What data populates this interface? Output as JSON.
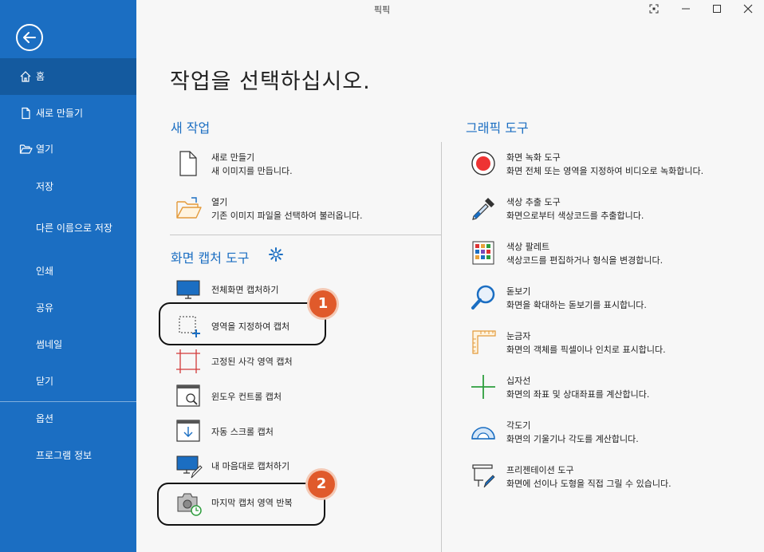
{
  "window": {
    "title": "픽픽",
    "icons": [
      "capture-icon",
      "minimize-icon",
      "maximize-icon",
      "close-icon"
    ]
  },
  "sidebar": {
    "back_icon": "arrow-left-icon",
    "items": [
      {
        "label": "홈",
        "icon": "home-icon",
        "active": true
      },
      {
        "label": "새로 만들기",
        "icon": "file-icon"
      },
      {
        "label": "열기",
        "icon": "folder-open-icon"
      },
      {
        "label": "저장"
      },
      {
        "label": "다른 이름으로 저장"
      },
      {
        "label": "인쇄"
      },
      {
        "label": "공유"
      },
      {
        "label": "썸네일"
      },
      {
        "label": "닫기"
      },
      {
        "label": "옵션"
      },
      {
        "label": "프로그램 정보"
      }
    ],
    "colors": {
      "background": "#1b6ec2",
      "active": "#145a9f"
    }
  },
  "main": {
    "title": "작업을 선택하십시오.",
    "new_task": {
      "heading": "새 작업",
      "items": [
        {
          "title": "새로 만들기",
          "desc": "새 이미지를 만듭니다.",
          "icon": "blank-file-icon"
        },
        {
          "title": "열기",
          "desc": "기존 이미지 파일을 선택하여 불러옵니다.",
          "icon": "open-folder-icon"
        }
      ]
    },
    "capture_tools": {
      "heading": "화면 캡처 도구",
      "settings_icon": "gear-icon",
      "items": [
        {
          "label": "전체화면 캡처하기",
          "icon": "monitor-icon"
        },
        {
          "label": "영역을 지정하여 캡처",
          "icon": "region-select-icon"
        },
        {
          "label": "고정된 사각 영역 캡처",
          "icon": "fixed-rect-icon"
        },
        {
          "label": "윈도우 컨트롤 캡처",
          "icon": "window-search-icon"
        },
        {
          "label": "자동 스크롤 캡처",
          "icon": "scroll-capture-icon"
        },
        {
          "label": "내 마음대로 캡처하기",
          "icon": "freehand-monitor-icon"
        },
        {
          "label": "마지막 캡처 영역 반복",
          "icon": "camera-repeat-icon"
        }
      ]
    },
    "graphic_tools": {
      "heading": "그래픽 도구",
      "items": [
        {
          "title": "화면 녹화 도구",
          "desc": "화면 전체 또는 영역을 지정하여 비디오로 녹화합니다.",
          "icon": "record-icon"
        },
        {
          "title": "색상 추출 도구",
          "desc": "화면으로부터 색상코드를 추출합니다.",
          "icon": "eyedropper-icon"
        },
        {
          "title": "색상 팔레트",
          "desc": "색상코드를 편집하거나 형식을 변경합니다.",
          "icon": "palette-grid-icon"
        },
        {
          "title": "돋보기",
          "desc": "화면을 확대하는 돋보기를 표시합니다.",
          "icon": "magnifier-icon"
        },
        {
          "title": "눈금자",
          "desc": "화면의 객체를 픽셀이나 인치로 표시합니다.",
          "icon": "ruler-icon"
        },
        {
          "title": "십자선",
          "desc": "화면의 좌표 및 상대좌표를 계산합니다.",
          "icon": "crosshair-icon"
        },
        {
          "title": "각도기",
          "desc": "화면의 기울기나 각도를 계산합니다.",
          "icon": "protractor-icon"
        },
        {
          "title": "프리젠테이션 도구",
          "desc": "화면에 선이나 도형을 직접 그릴 수 있습니다.",
          "icon": "presentation-board-icon"
        }
      ]
    },
    "annotations": [
      {
        "number": "1"
      },
      {
        "number": "2"
      }
    ],
    "accent_color": "#1b6ec2",
    "badge_color": "#e05a2b"
  }
}
